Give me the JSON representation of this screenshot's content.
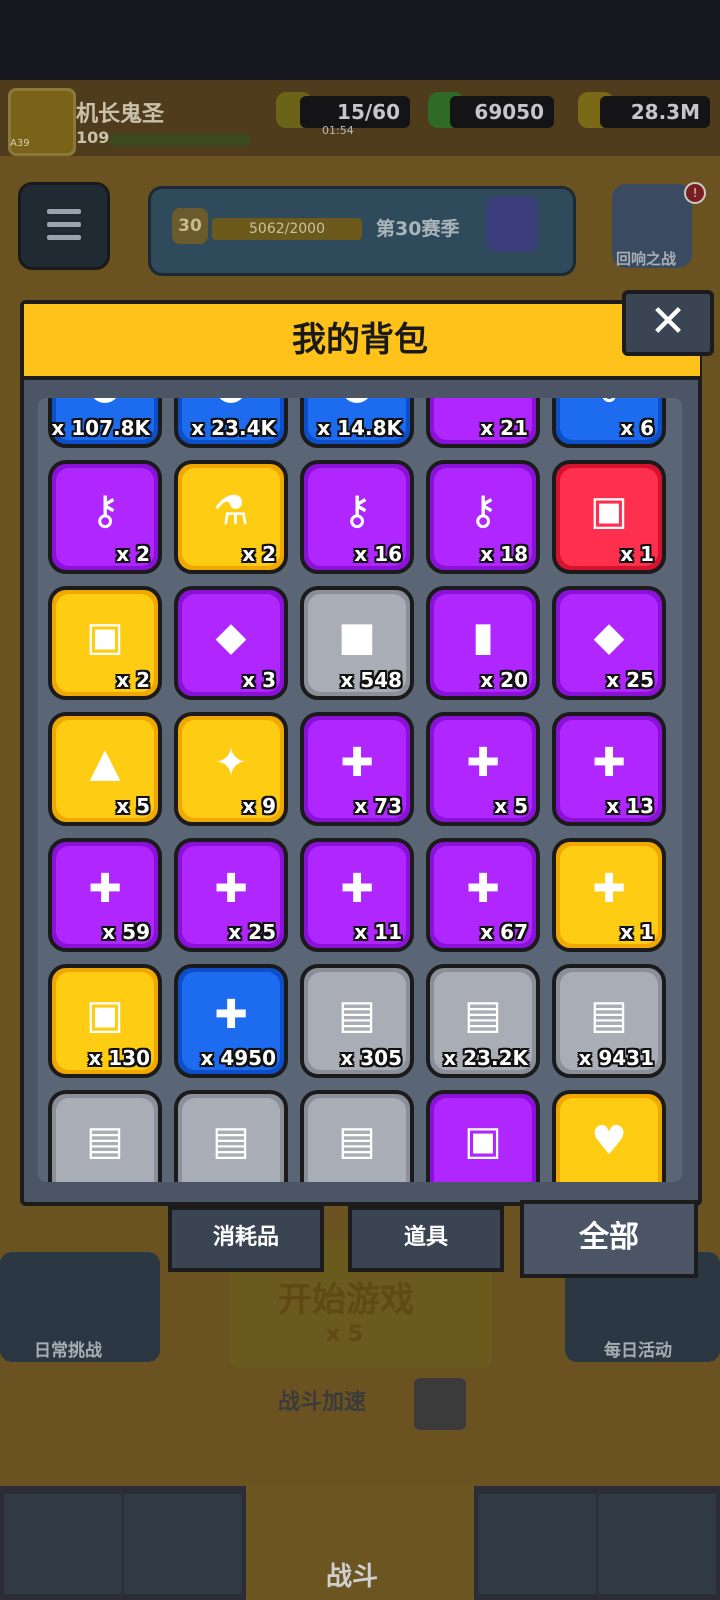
{
  "player": {
    "name": "机长鬼圣",
    "level": "109",
    "avatar_level": "A39"
  },
  "resources": {
    "energy": {
      "value": "15/60",
      "timer": "01:54"
    },
    "gems": "69050",
    "coins": "28.3M"
  },
  "season": {
    "level": "30",
    "progress": "5062/2000",
    "label": "第30赛季"
  },
  "echo_battle": {
    "label": "回响之战",
    "badge": "!"
  },
  "modal": {
    "title": "我的背包",
    "close": "✕"
  },
  "items": [
    {
      "count": "x 107.8K",
      "color": "blue",
      "icon": "coin-icon",
      "glyph": "●"
    },
    {
      "count": "x 23.4K",
      "color": "blue",
      "icon": "gold-coin-icon",
      "glyph": "●"
    },
    {
      "count": "x 14.8K",
      "color": "blue",
      "icon": "bronze-coin-icon",
      "glyph": "●"
    },
    {
      "count": "x 21",
      "color": "purple",
      "icon": "ticket-icon",
      "glyph": "▬"
    },
    {
      "count": "x 6",
      "color": "blue",
      "icon": "silver-key-icon",
      "glyph": "⚷"
    },
    {
      "count": "x 2",
      "color": "purple",
      "icon": "rose-key-icon",
      "glyph": "⚷"
    },
    {
      "count": "x 2",
      "color": "yellow",
      "icon": "potion-icon",
      "glyph": "⚗"
    },
    {
      "count": "x 16",
      "color": "purple",
      "icon": "purple-key-icon",
      "glyph": "⚷"
    },
    {
      "count": "x 18",
      "color": "purple",
      "icon": "gold-key-icon",
      "glyph": "⚷"
    },
    {
      "count": "x 1",
      "color": "red",
      "icon": "red-chest-icon",
      "glyph": "▣"
    },
    {
      "count": "x 2",
      "color": "yellow",
      "icon": "diamond-chest-icon",
      "glyph": "▣"
    },
    {
      "count": "x 3",
      "color": "purple",
      "icon": "gem-plate-icon",
      "glyph": "◆"
    },
    {
      "count": "x 548",
      "color": "grey",
      "icon": "cube-icon",
      "glyph": "■"
    },
    {
      "count": "x 20",
      "color": "purple",
      "icon": "cylinder-icon",
      "glyph": "▮"
    },
    {
      "count": "x 25",
      "color": "purple",
      "icon": "shard-icon",
      "glyph": "◆"
    },
    {
      "count": "x 5",
      "color": "yellow",
      "icon": "triangle-gem-icon",
      "glyph": "▲"
    },
    {
      "count": "x 9",
      "color": "yellow",
      "icon": "star-icon",
      "glyph": "✦"
    },
    {
      "count": "x 73",
      "color": "purple",
      "icon": "puzzle-hero-icon",
      "glyph": "✚"
    },
    {
      "count": "x 5",
      "color": "purple",
      "icon": "puzzle-hero-icon",
      "glyph": "✚"
    },
    {
      "count": "x 13",
      "color": "purple",
      "icon": "puzzle-hero-icon",
      "glyph": "✚"
    },
    {
      "count": "x 59",
      "color": "purple",
      "icon": "puzzle-hero-icon",
      "glyph": "✚"
    },
    {
      "count": "x 25",
      "color": "purple",
      "icon": "puzzle-hero-icon",
      "glyph": "✚"
    },
    {
      "count": "x 11",
      "color": "purple",
      "icon": "puzzle-hero-icon",
      "glyph": "✚"
    },
    {
      "count": "x 67",
      "color": "purple",
      "icon": "puzzle-hero-icon",
      "glyph": "✚"
    },
    {
      "count": "x 1",
      "color": "yellow",
      "icon": "s-puzzle-hero-icon",
      "glyph": "✚"
    },
    {
      "count": "x 130",
      "color": "yellow",
      "icon": "orange-chest-icon",
      "glyph": "▣"
    },
    {
      "count": "x 4950",
      "color": "blue",
      "icon": "blue-puzzle-icon",
      "glyph": "✚"
    },
    {
      "count": "x 305",
      "color": "grey",
      "icon": "blueprint-weapon-icon",
      "glyph": "▤"
    },
    {
      "count": "x 23.2K",
      "color": "grey",
      "icon": "blueprint-armor-icon",
      "glyph": "▤"
    },
    {
      "count": "x 9431",
      "color": "grey",
      "icon": "blueprint-necklace-icon",
      "glyph": "▤"
    },
    {
      "count": "",
      "color": "grey",
      "icon": "blueprint-belt-icon",
      "glyph": "▤"
    },
    {
      "count": "",
      "color": "grey",
      "icon": "blueprint-glove-icon",
      "glyph": "▤"
    },
    {
      "count": "",
      "color": "grey",
      "icon": "blueprint-boots-icon",
      "glyph": "▤"
    },
    {
      "count": "",
      "color": "purple",
      "icon": "purple-chest-icon",
      "glyph": "▣"
    },
    {
      "count": "",
      "color": "yellow",
      "icon": "heart-chest-icon",
      "glyph": "♥"
    }
  ],
  "tabs": {
    "consumables": "消耗品",
    "props": "道具",
    "all": "全部"
  },
  "background": {
    "daily_challenge": "日常挑战",
    "daily_activity": "每日活动",
    "start_game": "开始游戏",
    "start_cost": "x 5",
    "battle_speed": "战斗加速",
    "battle_tab": "战斗"
  },
  "palette": {
    "blue": [
      "#1d6cf0",
      "#0d4fc8"
    ],
    "purple": [
      "#b026ff",
      "#8a12d8"
    ],
    "yellow": [
      "#ffcc14",
      "#f0a800"
    ],
    "red": [
      "#ff2f4e",
      "#d6122f"
    ],
    "grey": [
      "#a9adb6",
      "#8a8f99"
    ]
  }
}
